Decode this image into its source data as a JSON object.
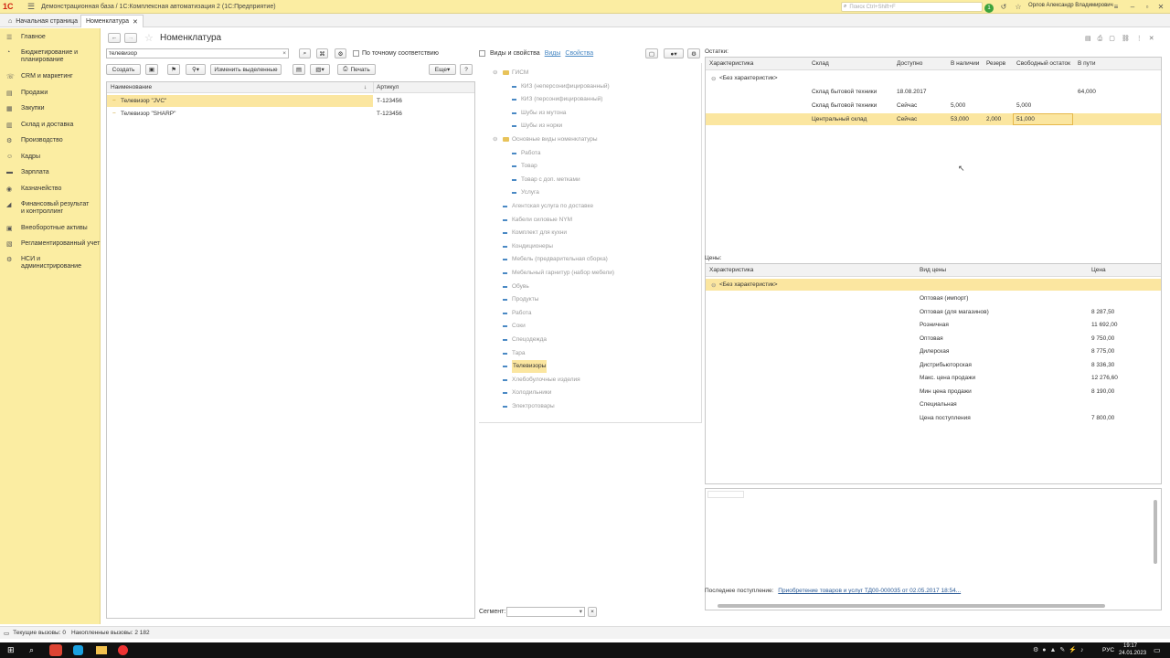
{
  "titlebar": {
    "app_title": "Демонстрационная база / 1С:Комплексная автоматизация 2  (1С:Предприятие)",
    "search_placeholder": "Поиск Ctrl+Shift+F",
    "notifications_badge": "1",
    "user_name": "Орлов Александр Владимирович"
  },
  "tabs": [
    {
      "label": "Начальная страница"
    },
    {
      "label": "Номенклатура"
    }
  ],
  "sidebar": {
    "items": [
      {
        "label": "Главное",
        "icon": "menu-icon"
      },
      {
        "label": "Бюджетирование и планирование",
        "icon": "budget-icon"
      },
      {
        "label": "CRM и маркетинг",
        "icon": "crm-icon"
      },
      {
        "label": "Продажи",
        "icon": "sales-icon"
      },
      {
        "label": "Закупки",
        "icon": "purchases-icon"
      },
      {
        "label": "Склад и доставка",
        "icon": "warehouse-icon"
      },
      {
        "label": "Производство",
        "icon": "production-icon"
      },
      {
        "label": "Кадры",
        "icon": "staff-icon"
      },
      {
        "label": "Зарплата",
        "icon": "salary-icon"
      },
      {
        "label": "Казначейство",
        "icon": "treasury-icon"
      },
      {
        "label": "Финансовый результат и контроллинг",
        "icon": "finance-icon"
      },
      {
        "label": "Внеоборотные активы",
        "icon": "assets-icon"
      },
      {
        "label": "Регламентированный учет",
        "icon": "accounting-icon"
      },
      {
        "label": "НСИ и администрирование",
        "icon": "settings-icon"
      }
    ]
  },
  "page": {
    "title": "Номенклатура"
  },
  "list": {
    "search_value": "телевизор",
    "exact_match_label": "По точному соответствию",
    "create_label": "Создать",
    "change_selected_label": "Изменить выделенные",
    "print_label": "Печать",
    "more_label": "Еще",
    "help_label": "?",
    "columns": [
      "Наименование",
      "Артикул"
    ],
    "rows": [
      {
        "name": "Телевизор \"JVC\"",
        "article": "Т-123456"
      },
      {
        "name": "Телевизор \"SHARP\"",
        "article": "Т-123456"
      }
    ]
  },
  "tree": {
    "toggle_label": "Виды и свойства",
    "link_kinds": "Виды",
    "link_props": "Свойства",
    "items": [
      {
        "label": "ГИСМ",
        "type": "folder",
        "level": 1
      },
      {
        "label": "КИЗ (неперсонифицированный)",
        "type": "leaf",
        "level": 2
      },
      {
        "label": "КИЗ (персонифицированный)",
        "type": "leaf",
        "level": 2
      },
      {
        "label": "Шубы из мутона",
        "type": "leaf",
        "level": 2
      },
      {
        "label": "Шубы из норки",
        "type": "leaf",
        "level": 2
      },
      {
        "label": "Основные виды номенклатуры",
        "type": "folder",
        "level": 1
      },
      {
        "label": "Работа",
        "type": "leaf",
        "level": 2
      },
      {
        "label": "Товар",
        "type": "leaf",
        "level": 2
      },
      {
        "label": "Товар с доп. метками",
        "type": "leaf",
        "level": 2
      },
      {
        "label": "Услуга",
        "type": "leaf",
        "level": 2
      },
      {
        "label": "Агентская услуга по доставке",
        "type": "leaf",
        "level": 1
      },
      {
        "label": "Кабели силовые NYM",
        "type": "leaf",
        "level": 1
      },
      {
        "label": "Комплект для кухни",
        "type": "leaf",
        "level": 1
      },
      {
        "label": "Кондиционеры",
        "type": "leaf",
        "level": 1
      },
      {
        "label": "Мебель (предварительная сборка)",
        "type": "leaf",
        "level": 1
      },
      {
        "label": "Мебельный гарнитур (набор мебели)",
        "type": "leaf",
        "level": 1
      },
      {
        "label": "Обувь",
        "type": "leaf",
        "level": 1
      },
      {
        "label": "Продукты",
        "type": "leaf",
        "level": 1
      },
      {
        "label": "Работа",
        "type": "leaf",
        "level": 1
      },
      {
        "label": "Соки",
        "type": "leaf",
        "level": 1
      },
      {
        "label": "Спецодежда",
        "type": "leaf",
        "level": 1
      },
      {
        "label": "Тара",
        "type": "leaf",
        "level": 1
      },
      {
        "label": "Телевизоры",
        "type": "leaf",
        "level": 1,
        "selected": true
      },
      {
        "label": "Хлебобулочные изделия",
        "type": "leaf",
        "level": 1
      },
      {
        "label": "Холодильники",
        "type": "leaf",
        "level": 1
      },
      {
        "label": "Электротовары",
        "type": "leaf",
        "level": 1
      }
    ],
    "segment_label": "Сегмент:"
  },
  "stock": {
    "label": "Остатки:",
    "columns": [
      "Характеристика",
      "Склад",
      "Доступно",
      "В наличии",
      "Резерв",
      "Свободный остаток",
      "В пути"
    ],
    "group": "<Без характеристик>",
    "rows": [
      {
        "warehouse": "Склад бытовой техники",
        "available": "18.08.2017",
        "in_stock": "",
        "reserve": "",
        "free": "",
        "transit": "64,000"
      },
      {
        "warehouse": "Склад бытовой техники",
        "available": "Сейчас",
        "in_stock": "5,000",
        "reserve": "",
        "free": "5,000",
        "transit": ""
      },
      {
        "warehouse": "Центральный склад",
        "available": "Сейчас",
        "in_stock": "53,000",
        "reserve": "2,000",
        "free": "51,000",
        "transit": ""
      }
    ]
  },
  "prices": {
    "label": "Цены:",
    "columns": [
      "Характеристика",
      "Вид цены",
      "Цена"
    ],
    "group": "<Без характеристик>",
    "rows": [
      {
        "kind": "Оптовая (импорт)",
        "price": ""
      },
      {
        "kind": "Оптовая (для магазинов)",
        "price": "8 287,50"
      },
      {
        "kind": "Розничная",
        "price": "11 692,00"
      },
      {
        "kind": "Оптовая",
        "price": "9 750,00"
      },
      {
        "kind": "Дилерская",
        "price": "8 775,00"
      },
      {
        "kind": "Дистрибьюторская",
        "price": "8 336,30"
      },
      {
        "kind": "Макс. цена продажи",
        "price": "12 276,60"
      },
      {
        "kind": "Мин цена продажи",
        "price": "8 190,00"
      },
      {
        "kind": "Специальная",
        "price": ""
      },
      {
        "kind": "Цена поступления",
        "price": "7 800,00"
      }
    ]
  },
  "last_receipt": {
    "label": "Последнее поступление:",
    "link": "Приобретение товаров и услуг ТД00-000035 от 02.05.2017 18:54..."
  },
  "status": {
    "current_calls": "Текущие вызовы: 0",
    "accumulated_calls": "Накопленные вызовы: 2 182"
  },
  "taskbar": {
    "lang": "РУС",
    "time": "19:17",
    "date": "24.01.2023"
  },
  "colors": {
    "brand_yellow": "#fbeda2",
    "selection": "#fbe6a0",
    "link": "#2a5a96"
  }
}
